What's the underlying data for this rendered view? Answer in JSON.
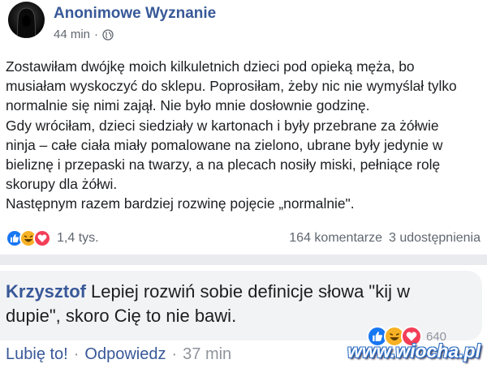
{
  "post": {
    "author": "Anonimowe Wyznanie",
    "time": "44 min",
    "separator": "·",
    "privacy_icon": "globe-icon",
    "lines": [
      "Zostawiłam dwójkę moich kilkuletnich dzieci pod opieką męża, bo",
      "musiałam wyskoczyć do sklepu. Poprosiłam, żeby nic nie wymyślał tylko",
      "normalnie się nimi zajął. Nie było mnie dosłownie godzinę.",
      "Gdy wróciłam, dzieci siedziały w kartonach i były przebrane za żółwie",
      "ninja – całe ciała miały pomalowane na zielono, ubrane były jedynie w",
      "bieliznę i przepaski na twarzy, a na plecach nosiły miski, pełniące rolę",
      "skorupy dla żółwi.",
      "Następnym razem bardziej rozwinę pojęcie „normalnie\"."
    ],
    "reactions": {
      "icons": [
        "like-icon",
        "haha-icon",
        "love-icon"
      ],
      "count": "1,4 tys."
    },
    "comments_count": "164 komentarze",
    "shares_count": "3 udostępnienia"
  },
  "comment": {
    "author": "Krzysztof",
    "text": "Lepiej rozwiń sobie definicje słowa \"kij w dupie\", skoro Cię to nie bawi.",
    "reactions": {
      "icons": [
        "like-icon",
        "haha-icon",
        "love-icon"
      ],
      "count": "640"
    },
    "actions": {
      "like": "Lubię to!",
      "reply": "Odpowiedz",
      "time": "37 min",
      "separator": "·"
    }
  },
  "watermark": "www.wiocha.pl",
  "colors": {
    "link_blue": "#385898",
    "like_blue": "#1877f2",
    "haha_yellow": "#f7b125",
    "love_red": "#f33e58",
    "meta_gray": "#606770",
    "divider_gray": "#e9ebee",
    "bubble_gray": "#f2f3f5"
  }
}
